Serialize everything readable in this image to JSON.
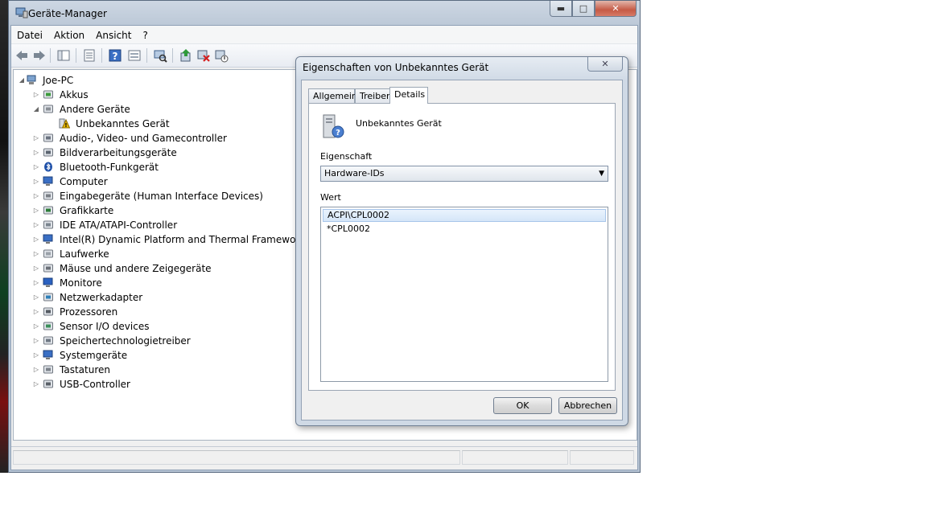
{
  "window": {
    "title": "Geräte-Manager",
    "minimize": "▬",
    "maximize": "□",
    "close": "✕"
  },
  "menu": [
    "Datei",
    "Aktion",
    "Ansicht",
    "?"
  ],
  "toolbar": [
    "back-icon",
    "forward-icon",
    "console-tree-icon",
    "properties-icon",
    "help-icon",
    "view-icon",
    "scan-hardware-icon",
    "update-driver-icon",
    "uninstall-icon",
    "disable-icon"
  ],
  "tree": {
    "root": "Joe-PC",
    "items": [
      {
        "label": "Akkus",
        "icon": "battery-icon",
        "level": 1,
        "expanded": false
      },
      {
        "label": "Andere Geräte",
        "icon": "other-devices-icon",
        "level": 1,
        "expanded": true
      },
      {
        "label": "Unbekanntes Gerät",
        "icon": "unknown-device-warning-icon",
        "level": 2,
        "expanded": null
      },
      {
        "label": "Audio-, Video- und Gamecontroller",
        "icon": "speaker-icon",
        "level": 1,
        "expanded": false
      },
      {
        "label": "Bildverarbeitungsgeräte",
        "icon": "camera-icon",
        "level": 1,
        "expanded": false
      },
      {
        "label": "Bluetooth-Funkgerät",
        "icon": "bluetooth-icon",
        "level": 1,
        "expanded": false
      },
      {
        "label": "Computer",
        "icon": "computer-icon",
        "level": 1,
        "expanded": false
      },
      {
        "label": "Eingabegeräte (Human Interface Devices)",
        "icon": "hid-icon",
        "level": 1,
        "expanded": false
      },
      {
        "label": "Grafikkarte",
        "icon": "display-adapter-icon",
        "level": 1,
        "expanded": false
      },
      {
        "label": "IDE ATA/ATAPI-Controller",
        "icon": "ide-controller-icon",
        "level": 1,
        "expanded": false
      },
      {
        "label": "Intel(R) Dynamic Platform and Thermal Framework",
        "icon": "thermal-icon",
        "level": 1,
        "expanded": false
      },
      {
        "label": "Laufwerke",
        "icon": "drive-icon",
        "level": 1,
        "expanded": false
      },
      {
        "label": "Mäuse und andere Zeigegeräte",
        "icon": "mouse-icon",
        "level": 1,
        "expanded": false
      },
      {
        "label": "Monitore",
        "icon": "monitor-icon",
        "level": 1,
        "expanded": false
      },
      {
        "label": "Netzwerkadapter",
        "icon": "network-icon",
        "level": 1,
        "expanded": false
      },
      {
        "label": "Prozessoren",
        "icon": "processor-icon",
        "level": 1,
        "expanded": false
      },
      {
        "label": "Sensor I/O devices",
        "icon": "sensor-icon",
        "level": 1,
        "expanded": false
      },
      {
        "label": "Speichertechnologietreiber",
        "icon": "storage-icon",
        "level": 1,
        "expanded": false
      },
      {
        "label": "Systemgeräte",
        "icon": "system-device-icon",
        "level": 1,
        "expanded": false
      },
      {
        "label": "Tastaturen",
        "icon": "keyboard-icon",
        "level": 1,
        "expanded": false
      },
      {
        "label": "USB-Controller",
        "icon": "usb-icon",
        "level": 1,
        "expanded": false
      }
    ]
  },
  "dialog": {
    "title": "Eigenschaften von Unbekanntes Gerät",
    "close": "✕",
    "tabs": [
      "Allgemein",
      "Treiber",
      "Details"
    ],
    "active_tab": "Details",
    "device_name": "Unbekanntes Gerät",
    "property_label": "Eigenschaft",
    "property_value": "Hardware-IDs",
    "value_label": "Wert",
    "values": [
      "ACPI\\CPL0002",
      "*CPL0002"
    ],
    "ok": "OK",
    "cancel": "Abbrechen"
  }
}
